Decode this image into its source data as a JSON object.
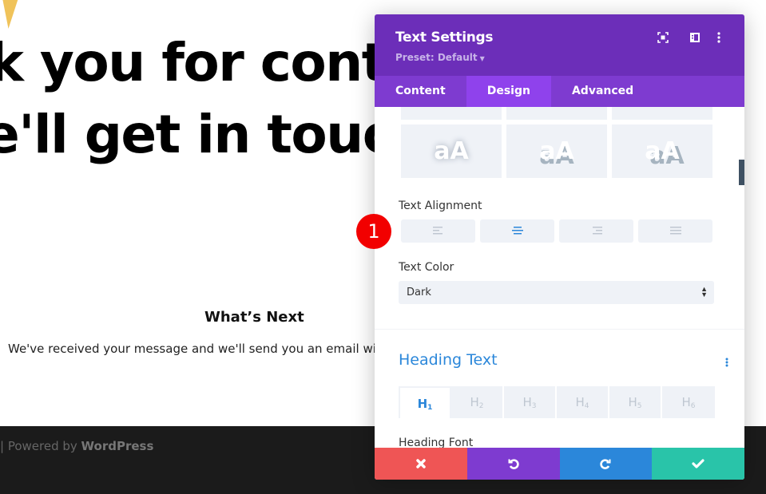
{
  "page": {
    "hero_line_1": "k you for cont",
    "hero_line_2": "e'll get in touc",
    "whats_next_heading": "What’s Next",
    "body_text": "We've received your message and we'll send you an email with",
    "footer_prefix": "| Powered by ",
    "footer_brand": "WordPress",
    "accent_color": "#f0c35a"
  },
  "annotation": {
    "badge_number": "1"
  },
  "modal": {
    "title": "Text Settings",
    "preset_label": "Preset: Default",
    "header_icons": [
      "expand-icon",
      "sidebar-layout-icon",
      "more-vertical-icon"
    ],
    "tabs": [
      {
        "label": "Content",
        "active": false
      },
      {
        "label": "Design",
        "active": true
      },
      {
        "label": "Advanced",
        "active": false
      }
    ],
    "text_shadow_presets": {
      "glyph": "aA",
      "styles": [
        "soft-glow",
        "bottom-offset",
        "diagonal-offset"
      ]
    },
    "text_alignment": {
      "label": "Text Alignment",
      "options": [
        "left",
        "center",
        "right",
        "justify"
      ],
      "selected": "center"
    },
    "text_color": {
      "label": "Text Color",
      "value": "Dark"
    },
    "heading_text": {
      "title": "Heading Text",
      "levels": [
        {
          "letter": "H",
          "num": "1",
          "active": true
        },
        {
          "letter": "H",
          "num": "2",
          "active": false
        },
        {
          "letter": "H",
          "num": "3",
          "active": false
        },
        {
          "letter": "H",
          "num": "4",
          "active": false
        },
        {
          "letter": "H",
          "num": "5",
          "active": false
        },
        {
          "letter": "H",
          "num": "6",
          "active": false
        }
      ],
      "font_label": "Heading Font"
    },
    "actions": [
      "cancel",
      "undo",
      "redo",
      "save"
    ],
    "colors": {
      "header": "#6c2eb9",
      "tabs": "#7e3bd0",
      "tab_active": "#8f42ec",
      "cancel": "#ef5555",
      "undo": "#7e3bd0",
      "redo": "#2b87da",
      "save": "#29c4a9",
      "accent": "#2b87da"
    }
  }
}
